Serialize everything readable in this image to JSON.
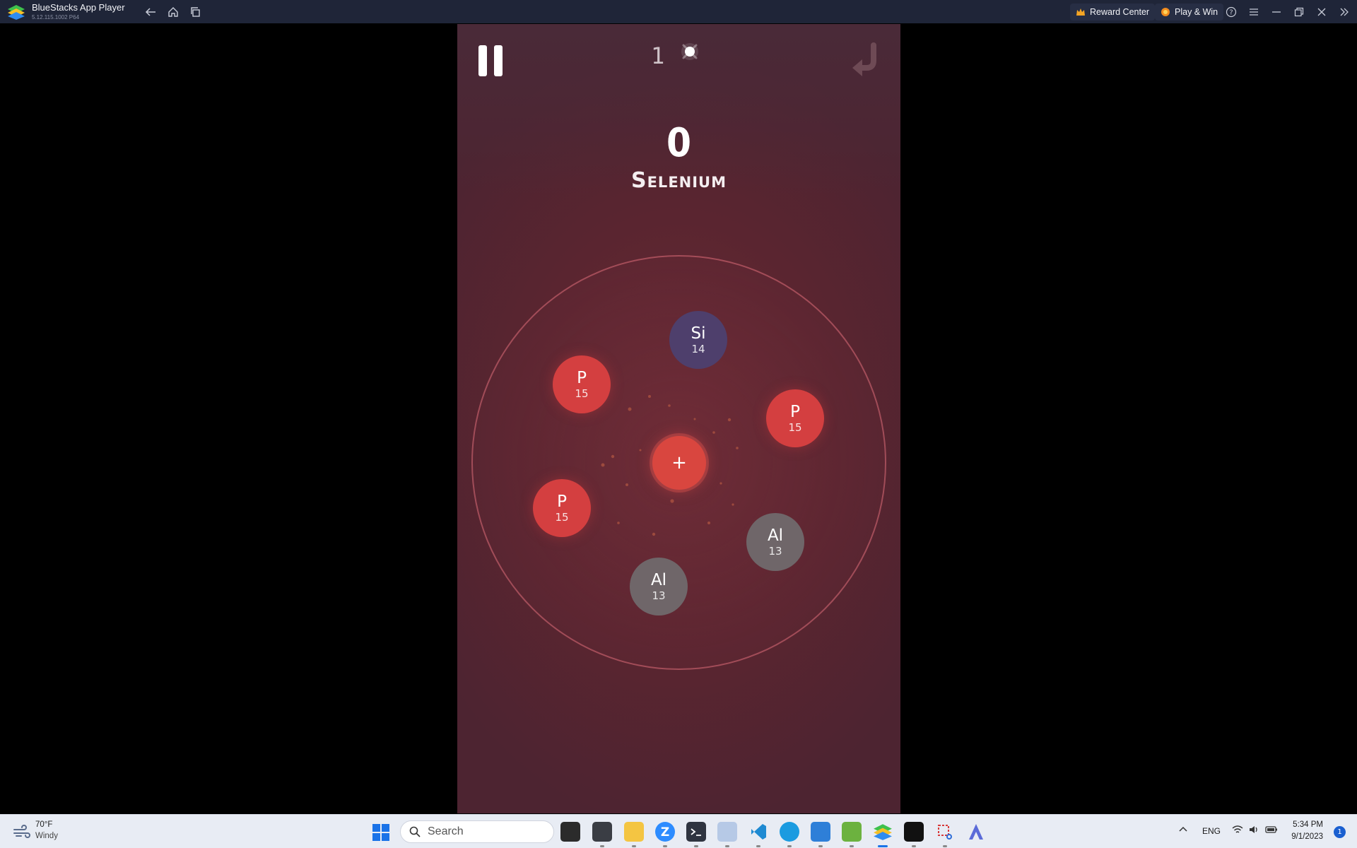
{
  "window": {
    "title": "BlueStacks App Player",
    "version": "5.12.115.1002 P64",
    "reward_center_label": "Reward Center",
    "play_win_label": "Play & Win"
  },
  "game": {
    "moves": "1",
    "score": "0",
    "element_name": "Selenium",
    "center_atom": "+",
    "atoms": [
      {
        "symbol": "Si",
        "number": "14",
        "kind": "si"
      },
      {
        "symbol": "P",
        "number": "15",
        "kind": "p"
      },
      {
        "symbol": "P",
        "number": "15",
        "kind": "p"
      },
      {
        "symbol": "P",
        "number": "15",
        "kind": "p"
      },
      {
        "symbol": "Al",
        "number": "13",
        "kind": "al"
      },
      {
        "symbol": "Al",
        "number": "13",
        "kind": "al"
      }
    ]
  },
  "taskbar": {
    "weather_temp": "70°F",
    "weather_desc": "Windy",
    "search_placeholder": "Search",
    "language": "ENG",
    "time": "5:34 PM",
    "date": "9/1/2023",
    "notification_count": "1"
  },
  "colors": {
    "phosphorus": "#d43f40",
    "silicon": "#4e3f6c",
    "aluminium": "#6f6669",
    "accent": "#1a73e8"
  }
}
